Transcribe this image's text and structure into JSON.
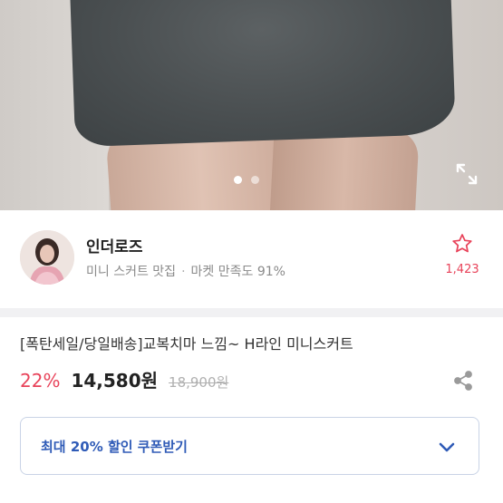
{
  "gallery": {
    "current_index": 1,
    "total": 2
  },
  "seller": {
    "name": "인더로즈",
    "tagline": "미니 스커트 맛집",
    "separator": "·",
    "satisfaction": "마켓 만족도 91%",
    "favorite_count": "1,423"
  },
  "product": {
    "title": "[폭탄세일/당일배송]교복치마 느낌~ H라인 미니스커트",
    "discount": "22%",
    "price": "14,580원",
    "original_price": "18,900원"
  },
  "coupon": {
    "label": "최대 20% 할인 쿠폰받기"
  },
  "colors": {
    "accent_pink": "#e8435a",
    "coupon_blue": "#2f5bb7",
    "divider": "#f1f1f3"
  },
  "icons": [
    "expand-icon",
    "star-outline-icon",
    "share-icon",
    "chevron-down-icon"
  ]
}
